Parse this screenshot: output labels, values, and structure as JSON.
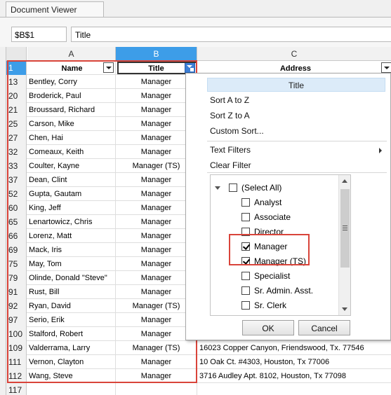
{
  "window": {
    "tab_title": "Document Viewer"
  },
  "formula_bar": {
    "cell_ref": "$B$1",
    "formula": "Title"
  },
  "columns": [
    "A",
    "B",
    "C"
  ],
  "header_row": {
    "row_number": "1",
    "name": "Name",
    "title": "Title",
    "address": "Address"
  },
  "rows": [
    {
      "num": "13",
      "name": "Bentley, Corry",
      "title": "Manager",
      "address": ""
    },
    {
      "num": "20",
      "name": "Broderick, Paul",
      "title": "Manager",
      "address": ""
    },
    {
      "num": "21",
      "name": "Broussard, Richard",
      "title": "Manager",
      "address": ""
    },
    {
      "num": "25",
      "name": "Carson, Mike",
      "title": "Manager",
      "address": ""
    },
    {
      "num": "27",
      "name": "Chen, Hai",
      "title": "Manager",
      "address": ""
    },
    {
      "num": "32",
      "name": "Comeaux, Keith",
      "title": "Manager",
      "address": ""
    },
    {
      "num": "33",
      "name": "Coulter, Kayne",
      "title": "Manager (TS)",
      "address": ""
    },
    {
      "num": "37",
      "name": "Dean, Clint",
      "title": "Manager",
      "address": ""
    },
    {
      "num": "52",
      "name": "Gupta, Gautam",
      "title": "Manager",
      "address": ""
    },
    {
      "num": "60",
      "name": "King, Jeff",
      "title": "Manager",
      "address": ""
    },
    {
      "num": "65",
      "name": "Lenartowicz, Chris",
      "title": "Manager",
      "address": ""
    },
    {
      "num": "66",
      "name": "Lorenz, Matt",
      "title": "Manager",
      "address": ""
    },
    {
      "num": "69",
      "name": "Mack, Iris",
      "title": "Manager",
      "address": ""
    },
    {
      "num": "75",
      "name": "May, Tom",
      "title": "Manager",
      "address": ""
    },
    {
      "num": "79",
      "name": "Olinde, Donald \"Steve\"",
      "title": "Manager",
      "address": ""
    },
    {
      "num": "91",
      "name": "Rust, Bill",
      "title": "Manager",
      "address": ""
    },
    {
      "num": "92",
      "name": "Ryan, David",
      "title": "Manager (TS)",
      "address": ""
    },
    {
      "num": "97",
      "name": "Serio, Erik",
      "title": "Manager",
      "address": ""
    },
    {
      "num": "100",
      "name": "Stalford, Robert",
      "title": "Manager",
      "address": ""
    },
    {
      "num": "109",
      "name": "Valderrama, Larry",
      "title": "Manager (TS)",
      "address": "16023 Copper Canyon, Friendswood, Tx. 77546"
    },
    {
      "num": "111",
      "name": "Vernon, Clayton",
      "title": "Manager",
      "address": "10 Oak Ct. #4303, Houston, Tx 77006"
    },
    {
      "num": "112",
      "name": "Wang, Steve",
      "title": "Manager",
      "address": "3716 Audley Apt. 8102, Houston, Tx 77098"
    },
    {
      "num": "117",
      "name": "",
      "title": "",
      "address": ""
    }
  ],
  "filter_popup": {
    "header": "Title",
    "sort_az": "Sort A to Z",
    "sort_za": "Sort Z to A",
    "custom_sort": "Custom Sort...",
    "text_filters": "Text Filters",
    "clear_filter": "Clear Filter",
    "options": [
      {
        "label": "(Select All)",
        "checked": false
      },
      {
        "label": "Analyst",
        "checked": false
      },
      {
        "label": "Associate",
        "checked": false
      },
      {
        "label": "Director",
        "checked": false
      },
      {
        "label": "Manager",
        "checked": true
      },
      {
        "label": "Manager (TS)",
        "checked": true
      },
      {
        "label": "Specialist",
        "checked": false
      },
      {
        "label": "Sr. Admin. Asst.",
        "checked": false
      },
      {
        "label": "Sr. Clerk",
        "checked": false
      }
    ],
    "ok_label": "OK",
    "cancel_label": "Cancel"
  },
  "colors": {
    "selection": "#3d9de8",
    "highlight": "#d9443a",
    "popup_header": "#dcebf9"
  }
}
